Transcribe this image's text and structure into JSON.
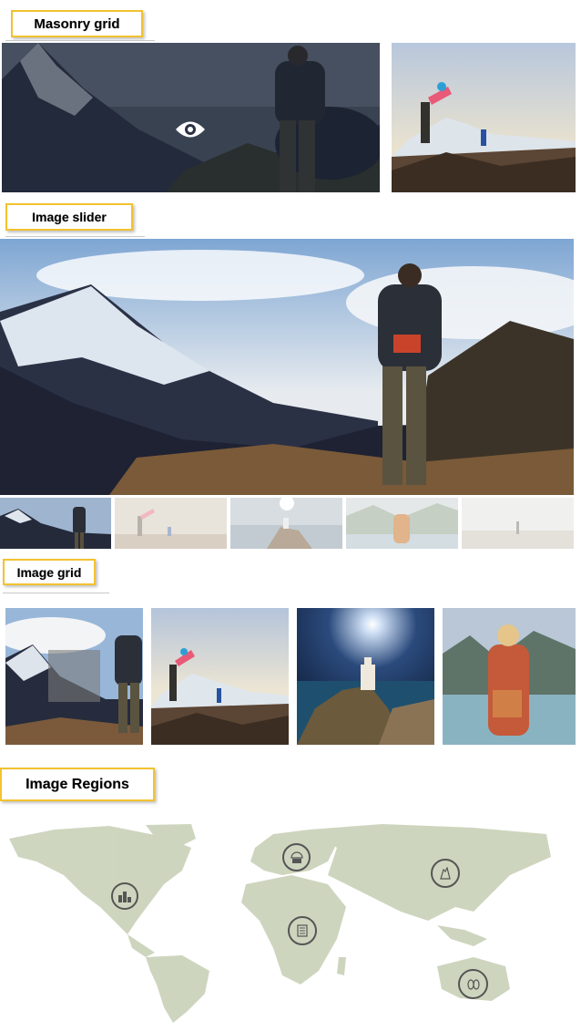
{
  "sections": {
    "masonry": {
      "title": "Masonry grid"
    },
    "slider": {
      "title": "Image slider"
    },
    "grid": {
      "title": "Image grid"
    },
    "regions": {
      "title": "Image Regions"
    }
  },
  "masonry_items": [
    "hiker-mountain",
    "jumping-woman"
  ],
  "slider": {
    "thumbnails": [
      "hiker-mountain",
      "jumping-woman",
      "lighthouse",
      "woman-lake",
      "beach-person"
    ]
  },
  "grid_items": [
    "hiker-mountain",
    "jumping-woman",
    "lighthouse",
    "woman-lake"
  ],
  "map_markers": [
    {
      "region": "north-america",
      "icon": "city-icon"
    },
    {
      "region": "europe",
      "icon": "landmark-icon"
    },
    {
      "region": "asia",
      "icon": "temple-icon"
    },
    {
      "region": "africa",
      "icon": "building-icon"
    },
    {
      "region": "australia",
      "icon": "people-icon"
    }
  ],
  "colors": {
    "accent": "#f2c230",
    "overlay": "#1c2433"
  }
}
